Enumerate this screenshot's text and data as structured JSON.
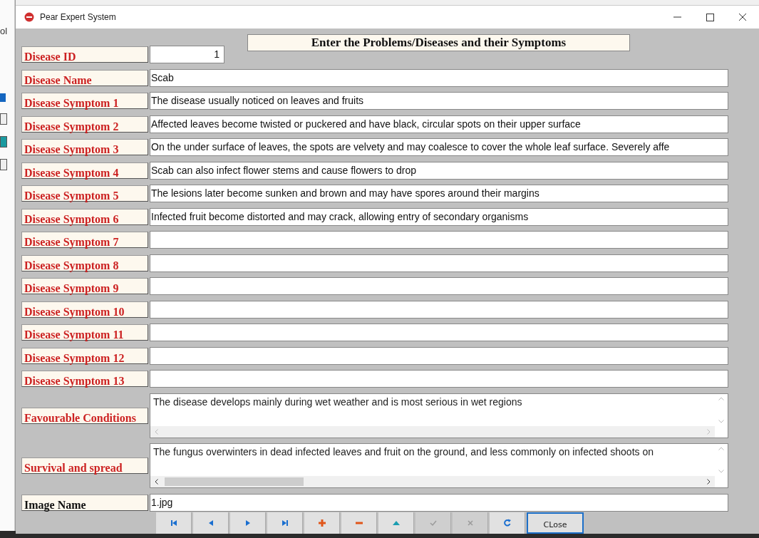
{
  "window": {
    "title": "Pear Expert System"
  },
  "background_window": {
    "text": "ol"
  },
  "form_title": "Enter the Problems/Diseases and their Symptoms",
  "fields": [
    {
      "label": "Disease ID",
      "value": "1",
      "kind": "number"
    },
    {
      "label": "Disease Name",
      "value": "Scab",
      "kind": "text"
    },
    {
      "label": "Disease Symptom 1",
      "value": "The disease usually noticed on leaves and fruits",
      "kind": "text"
    },
    {
      "label": "Disease Symptom 2",
      "value": "Affected leaves become twisted or puckered and have black, circular spots on their upper surface",
      "kind": "text"
    },
    {
      "label": "Disease Symptom 3",
      "value": "On the under surface of leaves, the spots are velvety and may coalesce to cover the whole leaf surface. Severely affe",
      "kind": "text"
    },
    {
      "label": "Disease Symptom 4",
      "value": "Scab can also infect flower stems and cause flowers to drop",
      "kind": "text"
    },
    {
      "label": "Disease Symptom 5",
      "value": "The lesions later become sunken and brown and may have spores around their margins",
      "kind": "text"
    },
    {
      "label": "Disease Symptom 6",
      "value": "Infected fruit become distorted and may crack, allowing entry of secondary organisms",
      "kind": "text"
    },
    {
      "label": "Disease Symptom 7",
      "kind": "text"
    },
    {
      "label": "Disease Symptom 8",
      "kind": "text"
    },
    {
      "label": "Disease Symptom 9",
      "kind": "text"
    },
    {
      "label": "Disease Symptom 10",
      "kind": "text"
    },
    {
      "label": "Disease Symptom 11",
      "kind": "text"
    },
    {
      "label": "Disease Symptom 12",
      "kind": "text"
    },
    {
      "label": "Disease Symptom 13",
      "kind": "text"
    }
  ],
  "memos": [
    {
      "label": "Favourable Conditions",
      "value": "The disease develops mainly during wet weather and is most serious in wet regions",
      "scrollable": false
    },
    {
      "label": "Survival and spread",
      "value": "The fungus overwinters in dead infected leaves and fruit on the ground, and less commonly on infected shoots on",
      "scrollable": true
    }
  ],
  "image_field": {
    "label": "Image Name",
    "value": "1.jpg"
  },
  "navigator": [
    {
      "kind": "first",
      "disabled": false
    },
    {
      "kind": "prior",
      "disabled": false
    },
    {
      "kind": "next",
      "disabled": false
    },
    {
      "kind": "last",
      "disabled": false
    },
    {
      "kind": "insert",
      "disabled": false
    },
    {
      "kind": "delete",
      "disabled": false
    },
    {
      "kind": "edit",
      "disabled": false
    },
    {
      "kind": "post",
      "disabled": true
    },
    {
      "kind": "cancel",
      "disabled": true
    },
    {
      "kind": "refresh",
      "disabled": false
    },
    {
      "kind": "close",
      "label": "CLose"
    }
  ]
}
